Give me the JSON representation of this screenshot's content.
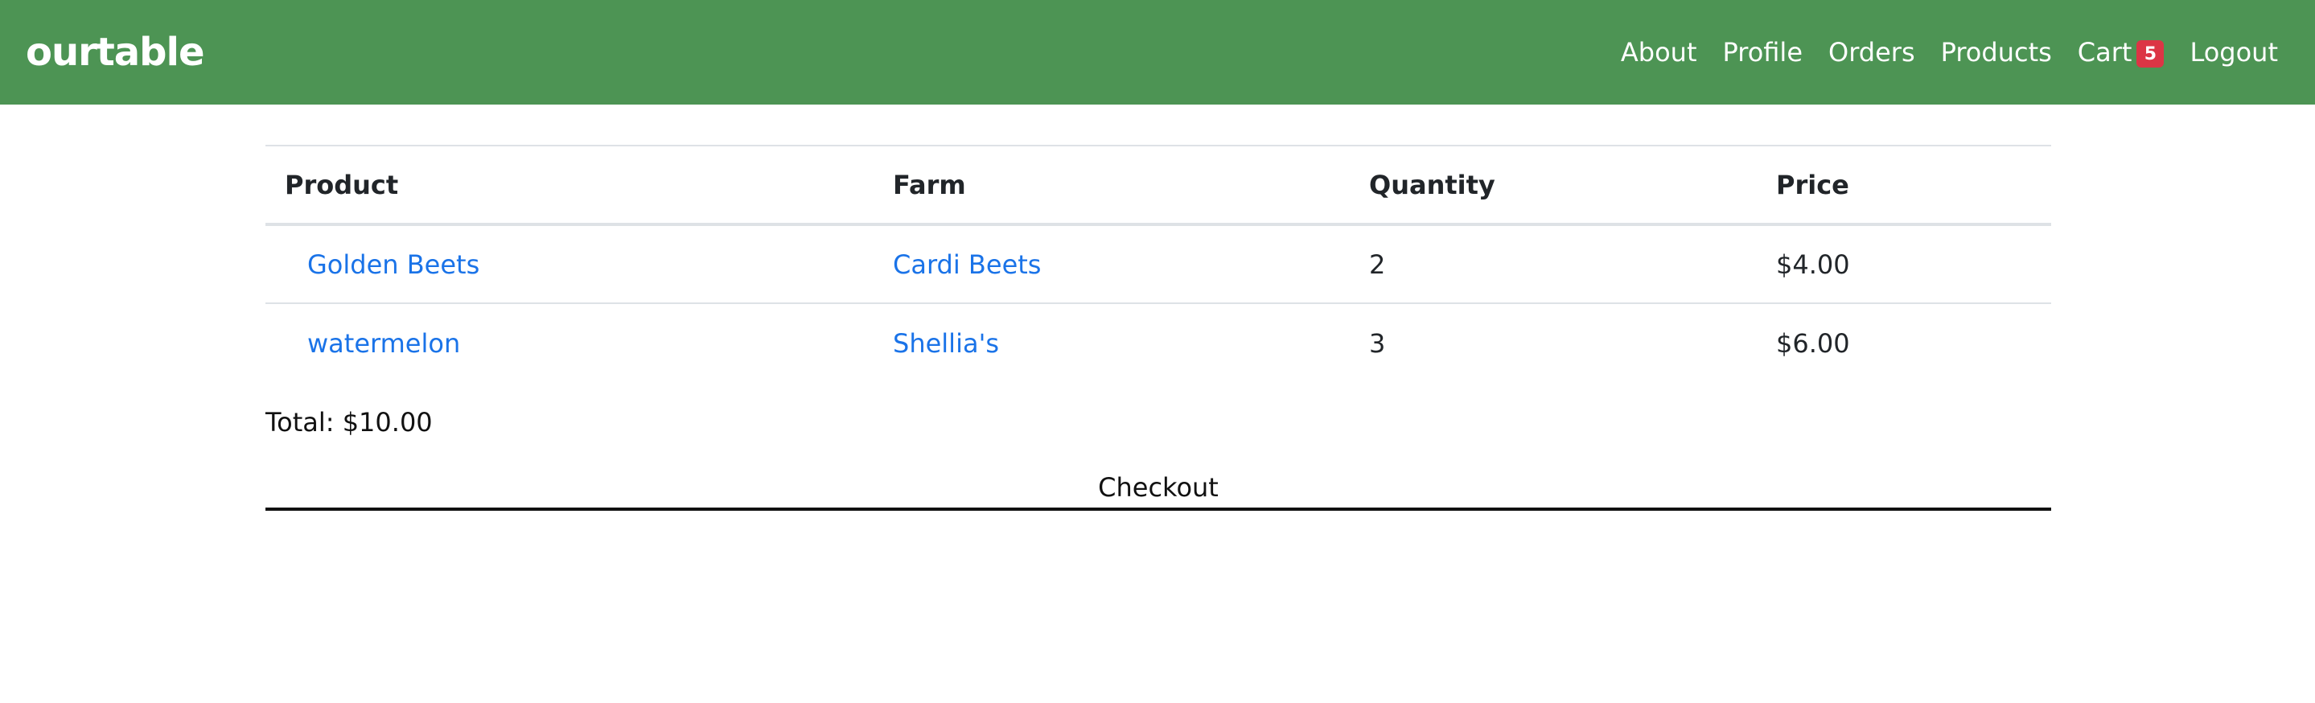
{
  "navbar": {
    "brand": "ourtable",
    "links": {
      "about": "About",
      "profile": "Profile",
      "orders": "Orders",
      "products": "Products",
      "cart": "Cart",
      "cart_count": "5",
      "logout": "Logout"
    },
    "background_color": "#4d9454",
    "badge_color": "#dc3545"
  },
  "cart": {
    "headers": [
      "Product",
      "Farm",
      "Quantity",
      "Price"
    ],
    "rows": [
      {
        "product": "Golden Beets",
        "farm": "Cardi Beets",
        "quantity": "2",
        "price": "$4.00"
      },
      {
        "product": "watermelon",
        "farm": "Shellia's",
        "quantity": "3",
        "price": "$6.00"
      }
    ],
    "total": "Total: $10.00",
    "checkout_label": "Checkout"
  },
  "colors": {
    "link": "#1a73e8"
  }
}
